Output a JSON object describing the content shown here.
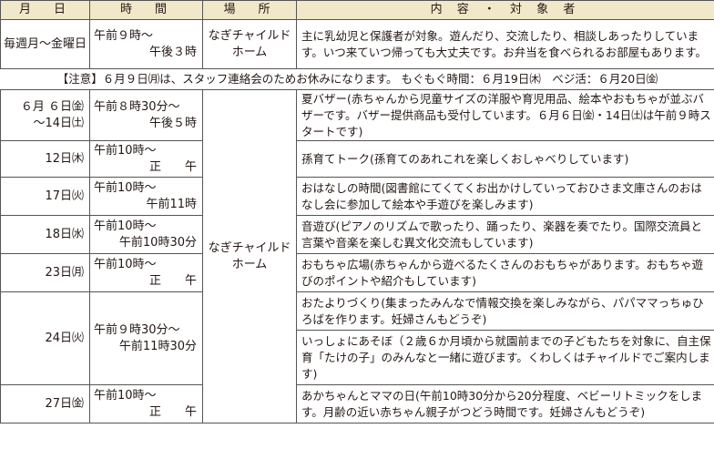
{
  "header": {
    "date": "月　日",
    "time": "時　間",
    "place": "場　所",
    "content": "内 容 ・ 対 象 者"
  },
  "row_weekday": {
    "date": "毎週月〜金曜日",
    "time1": "午前９時〜",
    "time2": "午後３時",
    "place": "なぎチャイルドホーム",
    "desc": "主に乳幼児と保護者が対象。遊んだり、交流したり、相談しあったりしています。いつ来ていつ帰っても大丈夫です。お弁当を食べられるお部屋もあります。"
  },
  "notice": "【注意】６月９日㈪は、スタッフ連絡会のためお休みになります。 もぐもぐ時間：６月19日㈭　べジ活：６月20日㈮",
  "place_shared": "なぎチャイルドホーム",
  "events": [
    {
      "date1": "６月 ６日㈮",
      "date2": "〜14日㈯",
      "time1": "午前８時30分〜",
      "time2": "午後５時",
      "desc": "夏バザー(赤ちゃんから児童サイズの洋服や育児用品、絵本やおもちゃが並ぶバザーです。バザー提供商品も受付しています。６月６日㈮・14日㈯は午前９時スタートです)"
    },
    {
      "date1": "12日㈭",
      "time1": "午前10時〜",
      "time2": "正　　午",
      "desc": "孫育てトーク(孫育てのあれこれを楽しくおしゃべりしています)"
    },
    {
      "date1": "17日㈫",
      "time1": "午前10時〜",
      "time2": "午前11時",
      "desc": "おはなしの時間(図書館にてくてくお出かけしていっておひさま文庫さんのおはなし会に参加して絵本や手遊びを楽しみます)"
    },
    {
      "date1": "18日㈬",
      "time1": "午前10時〜",
      "time2": "午前10時30分",
      "desc": "音遊び(ピアノのリズムで歌ったり、踊ったり、楽器を奏でたり。国際交流員と言葉や音楽を楽しむ異文化交流もしています)"
    },
    {
      "date1": "23日㈪",
      "time1": "午前10時〜",
      "time2": "正　　午",
      "desc": "おもちゃ広場(赤ちゃんから遊べるたくさんのおもちゃがあります。おもちゃ遊びのポイントや紹介もしています)"
    },
    {
      "date1": "24日㈫",
      "time1": "午前９時30分〜",
      "time2": "午前11時30分",
      "desc": "おたよりづくり(集まったみんなで情報交換を楽しみながら、パパママっちゅひろばを作ります。妊婦さんもどうぞ)",
      "desc_b": "いっしょにあそぼ（２歳６か月頃から就園前までの子どもたちを対象に、自主保育「たけの子」のみんなと一緒に遊びます。くわしくはチャイルドでご案内します)"
    },
    {
      "date1": "27日㈮",
      "time1": "午前10時〜",
      "time2": "正　　午",
      "desc": "あかちゃんとママの日(午前10時30分から20分程度、ベビーリトミックをします。月齢の近い赤ちゃん親子がつどう時間です。妊婦さんもどうぞ)"
    }
  ]
}
